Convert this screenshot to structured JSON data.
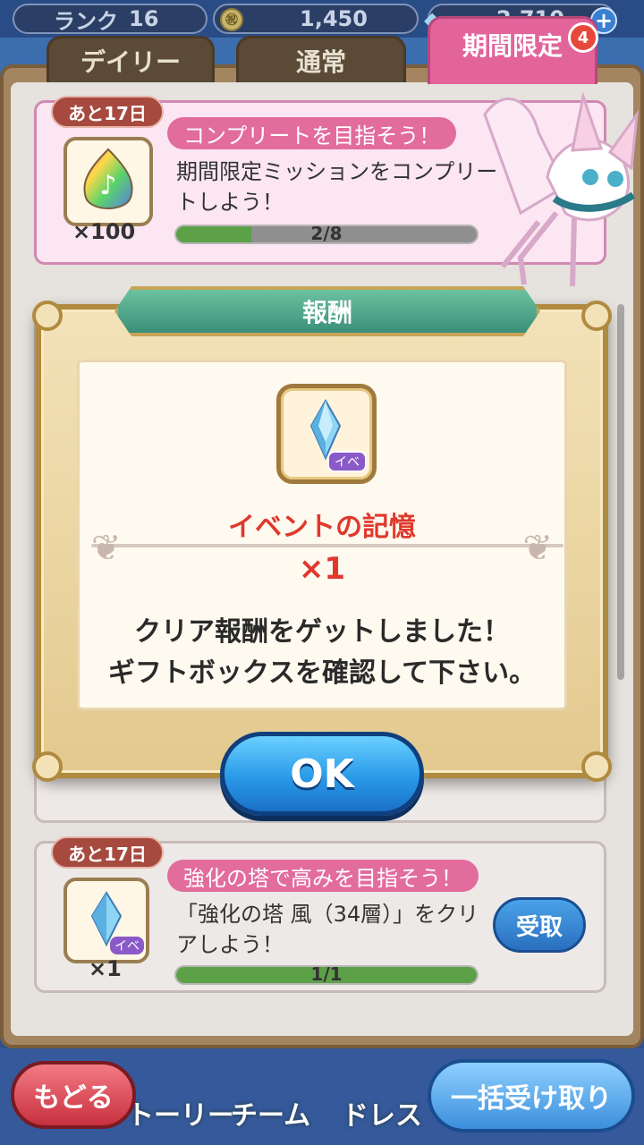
{
  "status": {
    "rank_label": "ランク",
    "rank_value": "16",
    "coin_icon_glyph": "㊗",
    "coins": "1,450",
    "gems": "2,710"
  },
  "tabs": [
    {
      "label": "デイリー"
    },
    {
      "label": "通常"
    },
    {
      "label": "期間限定",
      "badge": "4"
    }
  ],
  "missions": [
    {
      "deadline": "あと17日",
      "title": "コンプリートを目指そう！",
      "description": "期間限定ミッションをコンプリートしよう！",
      "reward_count": "×100",
      "progress_text": "2/8",
      "progress_fraction": 0.25
    },
    {
      "deadline": "あと17日",
      "title": "強化の塔で高みを目指そう！",
      "description": "「強化の塔 風（34層）」をクリアしよう！",
      "reward_count": "×1",
      "reward_badge": "イベ",
      "progress_text": "1/1",
      "progress_fraction": 1.0,
      "claim_label": "受取"
    }
  ],
  "modal": {
    "header": "報酬",
    "reward_badge": "イベ",
    "reward_name": "イベントの記憶",
    "reward_qty": "×1",
    "message_line1": "クリア報酬をゲットしました！",
    "message_line2": "ギフトボックスを確認して下さい。",
    "ok_label": "OK"
  },
  "bottom_nav": {
    "back_label": "もどる",
    "story_label": "トーリー",
    "team_label": "チーム",
    "dress_label": "ドレス",
    "claim_all_label": "一括受け取り"
  },
  "colors": {
    "accent_pink": "#e26c9c",
    "modal_header_green": "#3a8f78",
    "ok_blue": "#2a9ae8",
    "reward_red": "#e0382c"
  }
}
